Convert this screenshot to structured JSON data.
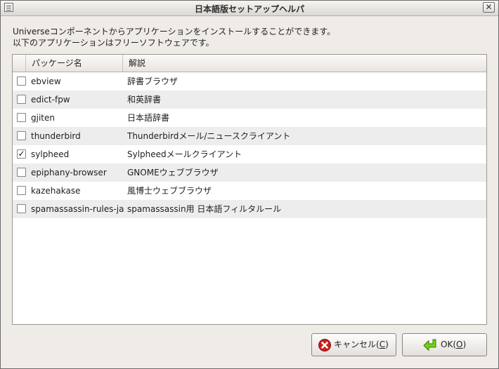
{
  "window": {
    "title": "日本語版セットアップヘルパ",
    "close_glyph": "✕"
  },
  "description": {
    "line1": "Universeコンポーネントからアプリケーションをインストールすることができます。",
    "line2": "以下のアプリケーションはフリーソフトウェアです。"
  },
  "list": {
    "headers": {
      "check": "",
      "package": "パッケージ名",
      "desc": "解説"
    },
    "rows": [
      {
        "package": "ebview",
        "desc": "辞書ブラウザ",
        "checked": false,
        "mark": ""
      },
      {
        "package": "edict-fpw",
        "desc": "和英辞書",
        "checked": false,
        "mark": ""
      },
      {
        "package": "gjiten",
        "desc": "日本語辞書",
        "checked": false,
        "mark": ""
      },
      {
        "package": "thunderbird",
        "desc": "Thunderbirdメール/ニュースクライアント",
        "checked": false,
        "mark": ""
      },
      {
        "package": "sylpheed",
        "desc": "Sylpheedメールクライアント",
        "checked": true,
        "mark": "✓"
      },
      {
        "package": "epiphany-browser",
        "desc": "GNOMEウェブブラウザ",
        "checked": false,
        "mark": ""
      },
      {
        "package": "kazehakase",
        "desc": "風博士ウェブブラウザ",
        "checked": false,
        "mark": ""
      },
      {
        "package": "spamassassin-rules-ja",
        "desc": "spamassassin用 日本語フィルタルール",
        "checked": false,
        "mark": ""
      }
    ]
  },
  "buttons": {
    "cancel": {
      "label_pre": "キャンセル(",
      "mnemonic": "C",
      "label_post": ")",
      "icon": "cancel-icon",
      "color": "#cc1f1f"
    },
    "ok": {
      "label_pre": "OK(",
      "mnemonic": "O",
      "label_post": ")",
      "icon": "enter-arrow-icon",
      "color": "#4e9a06"
    }
  }
}
